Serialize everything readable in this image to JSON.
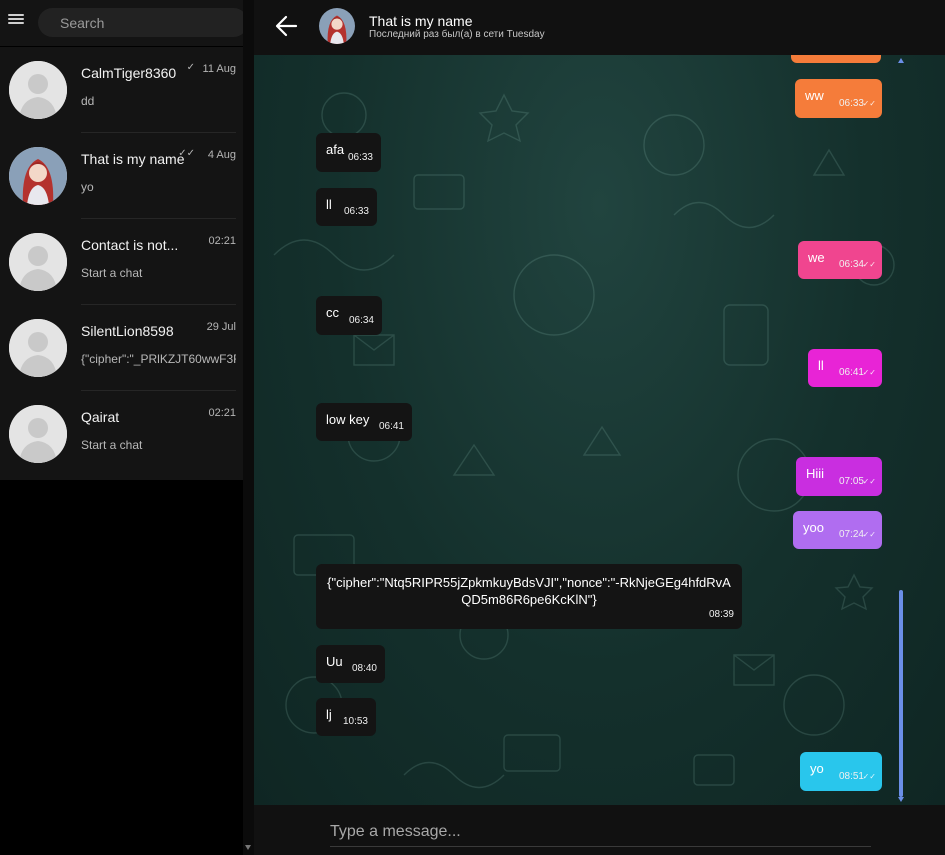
{
  "search": {
    "placeholder": "Search"
  },
  "icons": {
    "menu": "hamburger-menu-icon",
    "back": "arrow-left-icon",
    "read": "double-check-icon"
  },
  "chats": [
    {
      "name": "CalmTiger8360",
      "time": "11 Aug",
      "preview": "dd",
      "read_check": "✓",
      "avatar": "default"
    },
    {
      "name": "That is my name",
      "time": "4 Aug",
      "preview": "yo",
      "read_check": "✓✓",
      "avatar": "anime"
    },
    {
      "name": "Contact is not...",
      "time": "02:21",
      "preview": "Start a chat",
      "read_check": "",
      "avatar": "default"
    },
    {
      "name": "SilentLion8598",
      "time": "29 Jul",
      "preview": "{\"cipher\":\"_PRlKZJT60wwF3F",
      "read_check": "",
      "avatar": "default"
    },
    {
      "name": "Qairat",
      "time": "02:21",
      "preview": "Start a chat",
      "read_check": "",
      "avatar": "default"
    }
  ],
  "header": {
    "name": "That is my name",
    "status": "Последний раз был(а) в сети Tuesday"
  },
  "messages": [
    {
      "dir": "out",
      "text": "ww",
      "time": "06:33",
      "color": "#f57c3a"
    },
    {
      "dir": "in",
      "text": "afa",
      "time": "06:33"
    },
    {
      "dir": "in",
      "text": "ll",
      "time": "06:33"
    },
    {
      "dir": "out",
      "text": "we",
      "time": "06:34",
      "color": "#f0458f"
    },
    {
      "dir": "in",
      "text": "cc",
      "time": "06:34"
    },
    {
      "dir": "out",
      "text": "ll",
      "time": "06:41",
      "color": "#e824d6"
    },
    {
      "dir": "in",
      "text": "low key",
      "time": "06:41"
    },
    {
      "dir": "out",
      "text": "Hiii",
      "time": "07:05",
      "color": "#c92ee0"
    },
    {
      "dir": "out",
      "text": "yoo",
      "time": "07:24",
      "color": "#b06df0"
    },
    {
      "dir": "in",
      "text": "{\"cipher\":\"Ntq5RIPR55jZpkmkuyBdsVJI\",\"nonce\":\"-RkNjeGEg4hfdRvAQD5m86R6pe6KcKlN\"}",
      "time": "08:39"
    },
    {
      "dir": "in",
      "text": "Uu",
      "time": "08:40"
    },
    {
      "dir": "in",
      "text": "lj",
      "time": "10:53"
    },
    {
      "dir": "out",
      "text": "yo",
      "time": "08:51",
      "color": "#29c6ec"
    }
  ],
  "composer": {
    "placeholder": "Type a message..."
  },
  "colors": {
    "accent_scroll": "#6b8fe8",
    "chat_bg": "#1a3a36",
    "incoming_bubble": "#141414"
  }
}
